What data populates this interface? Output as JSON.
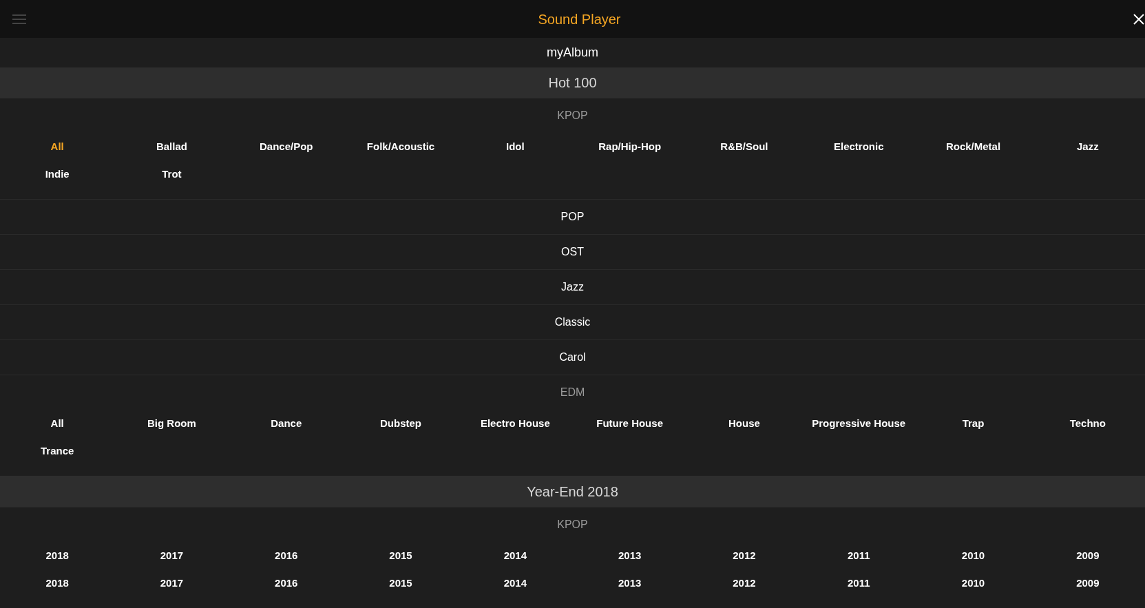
{
  "top_bar": {
    "title": "Sound Player"
  },
  "menu": [
    {
      "kind": "link",
      "label": "myAlbum"
    },
    {
      "kind": "header",
      "label": "Hot 100"
    },
    {
      "kind": "category",
      "label": "KPOP",
      "expanded": true,
      "items": [
        {
          "label": "All",
          "selected": true
        },
        {
          "label": "Ballad",
          "selected": false
        },
        {
          "label": "Dance/Pop",
          "selected": false
        },
        {
          "label": "Folk/Acoustic",
          "selected": false
        },
        {
          "label": "Idol",
          "selected": false
        },
        {
          "label": "Rap/Hip-Hop",
          "selected": false
        },
        {
          "label": "R&B/Soul",
          "selected": false
        },
        {
          "label": "Electronic",
          "selected": false
        },
        {
          "label": "Rock/Metal",
          "selected": false
        },
        {
          "label": "Jazz",
          "selected": false
        },
        {
          "label": "Indie",
          "selected": false
        },
        {
          "label": "Trot",
          "selected": false
        }
      ]
    },
    {
      "kind": "category",
      "label": "POP",
      "expanded": false
    },
    {
      "kind": "category",
      "label": "OST",
      "expanded": false
    },
    {
      "kind": "category",
      "label": "Jazz",
      "expanded": false
    },
    {
      "kind": "category",
      "label": "Classic",
      "expanded": false
    },
    {
      "kind": "category",
      "label": "Carol",
      "expanded": false
    },
    {
      "kind": "category",
      "label": "EDM",
      "expanded": true,
      "items": [
        {
          "label": "All",
          "selected": false
        },
        {
          "label": "Big Room",
          "selected": false
        },
        {
          "label": "Dance",
          "selected": false
        },
        {
          "label": "Dubstep",
          "selected": false
        },
        {
          "label": "Electro House",
          "selected": false
        },
        {
          "label": "Future House",
          "selected": false
        },
        {
          "label": "House",
          "selected": false
        },
        {
          "label": "Progressive House",
          "selected": false
        },
        {
          "label": "Trap",
          "selected": false
        },
        {
          "label": "Techno",
          "selected": false
        },
        {
          "label": "Trance",
          "selected": false
        }
      ]
    },
    {
      "kind": "header",
      "label": "Year-End 2018"
    },
    {
      "kind": "category",
      "label": "KPOP",
      "expanded": true,
      "items": [
        {
          "label": "2018",
          "selected": false
        },
        {
          "label": "2017",
          "selected": false
        },
        {
          "label": "2016",
          "selected": false
        },
        {
          "label": "2015",
          "selected": false
        },
        {
          "label": "2014",
          "selected": false
        },
        {
          "label": "2013",
          "selected": false
        },
        {
          "label": "2012",
          "selected": false
        },
        {
          "label": "2011",
          "selected": false
        },
        {
          "label": "2010",
          "selected": false
        },
        {
          "label": "2009",
          "selected": false
        },
        {
          "label": "2018",
          "selected": false
        },
        {
          "label": "2017",
          "selected": false
        },
        {
          "label": "2016",
          "selected": false
        },
        {
          "label": "2015",
          "selected": false
        },
        {
          "label": "2014",
          "selected": false
        },
        {
          "label": "2013",
          "selected": false
        },
        {
          "label": "2012",
          "selected": false
        },
        {
          "label": "2011",
          "selected": false
        },
        {
          "label": "2010",
          "selected": false
        },
        {
          "label": "2009",
          "selected": false
        }
      ]
    }
  ]
}
